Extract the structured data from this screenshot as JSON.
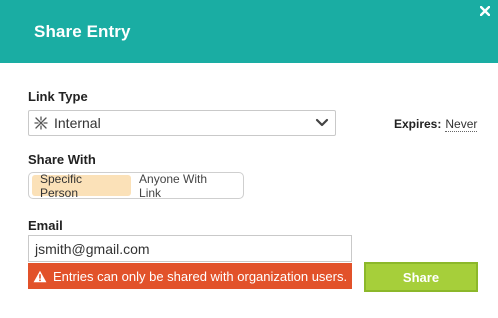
{
  "dialog": {
    "title": "Share Entry"
  },
  "link_type": {
    "label": "Link Type",
    "value": "Internal",
    "icon": "ban-icon"
  },
  "expires": {
    "label": "Expires:",
    "value": "Never"
  },
  "share_with": {
    "label": "Share With",
    "options": [
      "Specific Person",
      "Anyone With Link"
    ],
    "selected": "Specific Person"
  },
  "email": {
    "label": "Email",
    "value": "jsmith@gmail.com"
  },
  "error": {
    "message": "Entries can only be shared with organization users."
  },
  "actions": {
    "share_label": "Share"
  },
  "colors": {
    "header": "#1aada3",
    "segment_active": "#fbe1b8",
    "error": "#e2522a",
    "share_button": "#a6cf3a"
  }
}
